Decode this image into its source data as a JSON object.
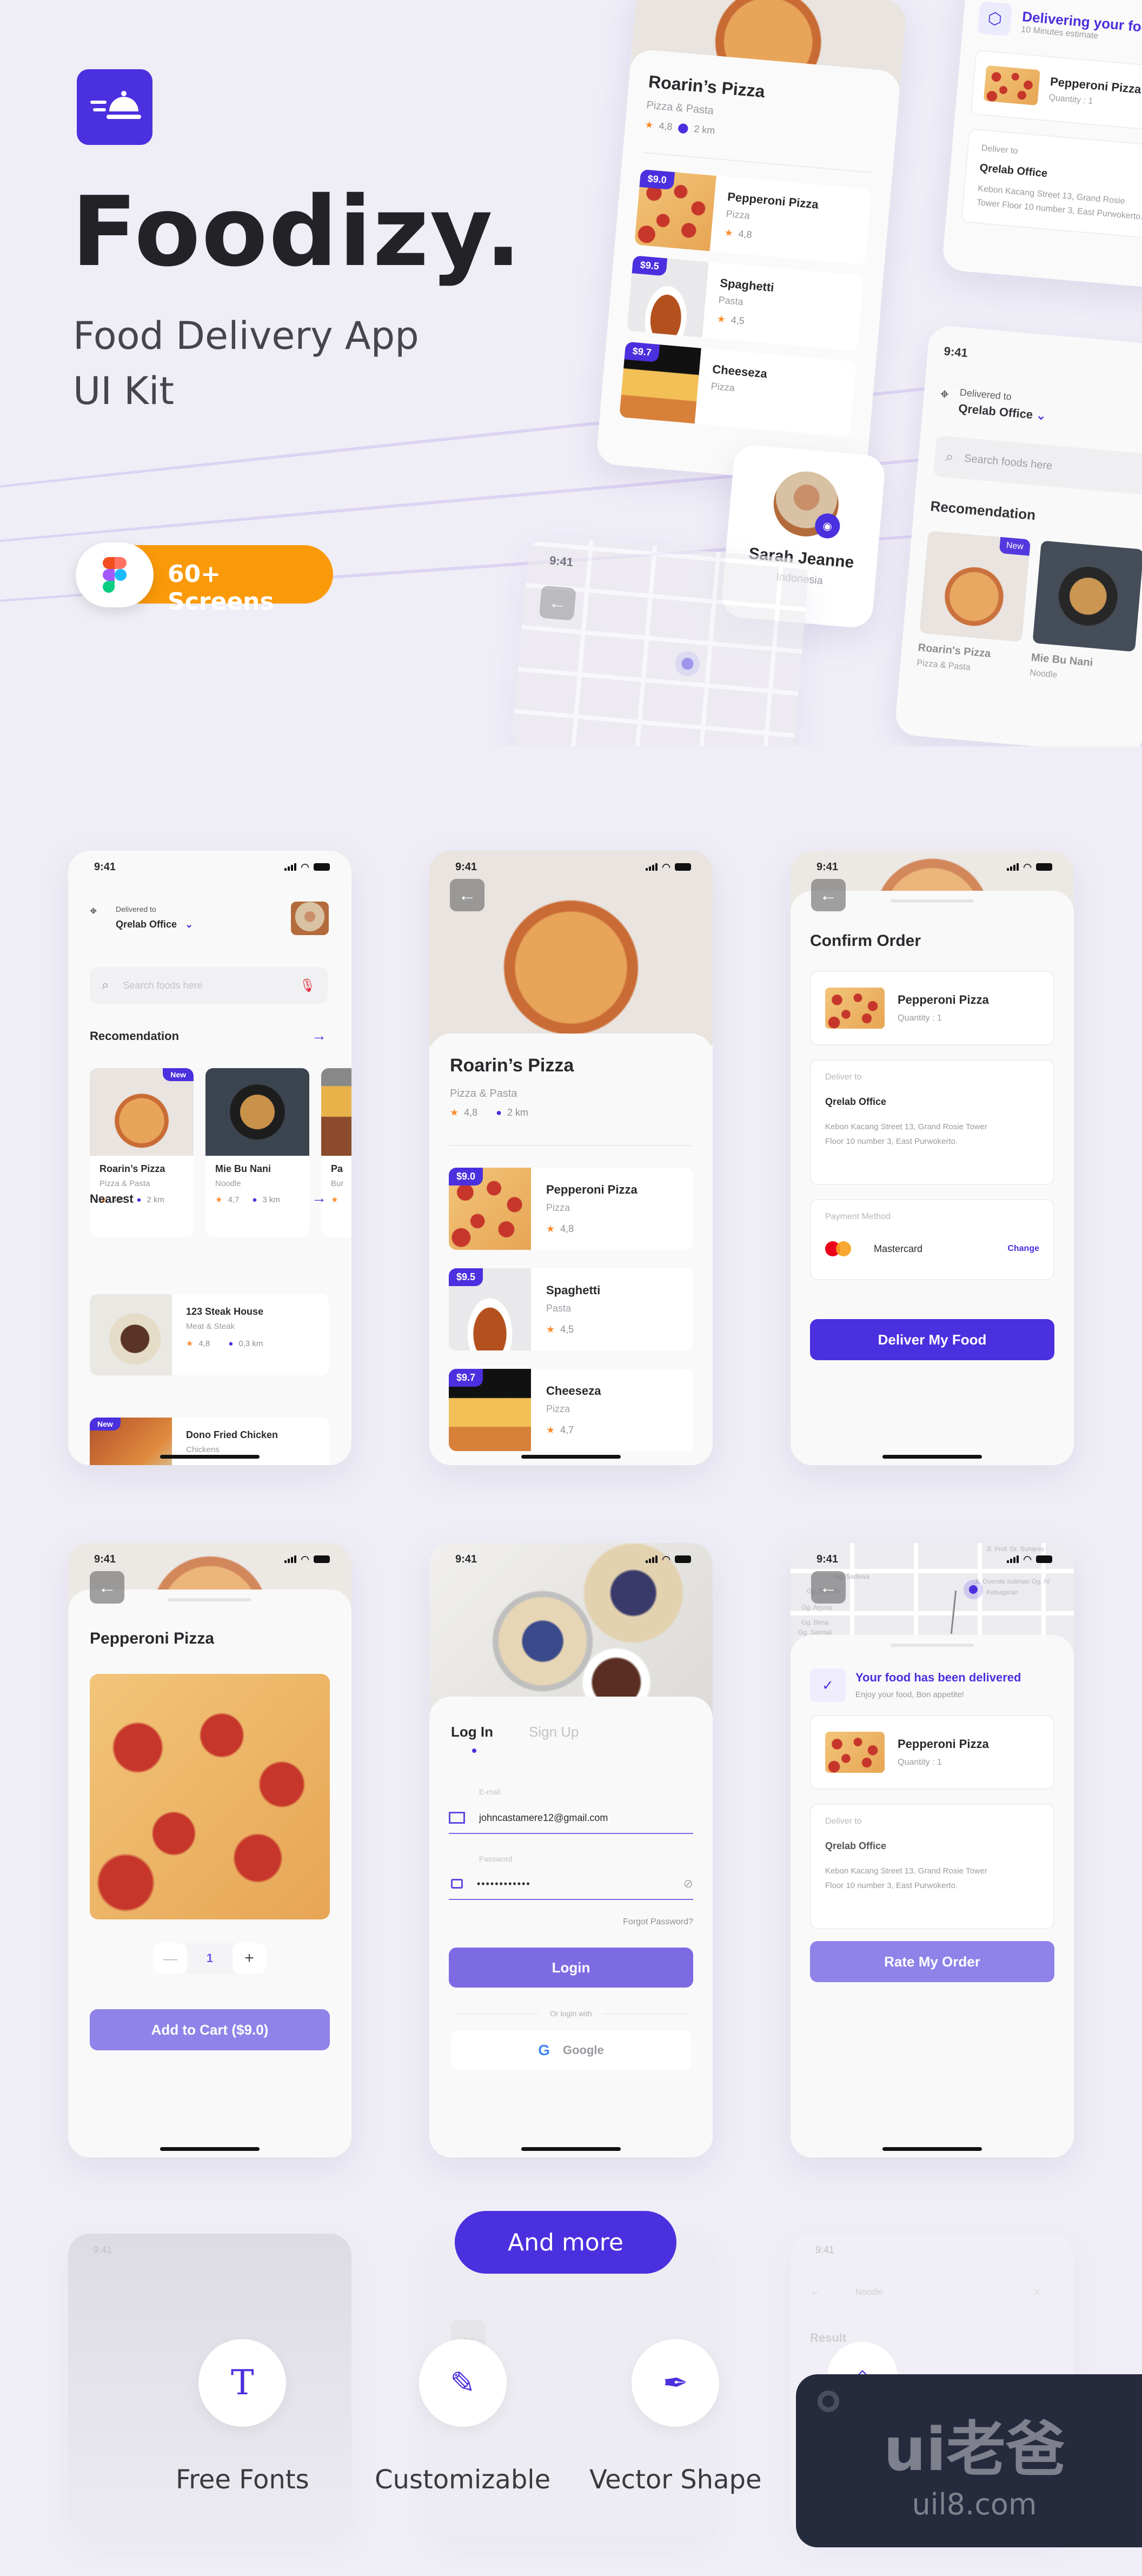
{
  "hero": {
    "brand": "Foodizy.",
    "subtitle_line1": "Food Delivery App",
    "subtitle_line2": "UI Kit",
    "badge_label": "60+ Screens",
    "logo_icon": "cloche-delivery-icon",
    "figma_icon": "figma-logo-icon",
    "colors": {
      "accent": "#4a30de",
      "badge": "#fb9a09",
      "background": "#efedf6"
    }
  },
  "hero_preview": {
    "restaurant": {
      "name": "Roarin’s Pizza",
      "category": "Pizza & Pasta",
      "rating": "4,8",
      "distance": "2 km"
    },
    "menu": [
      {
        "price": "$9.0",
        "name": "Pepperoni Pizza",
        "category": "Pizza",
        "rating": "4,8"
      },
      {
        "price": "$9.5",
        "name": "Spaghetti",
        "category": "Pasta",
        "rating": "4,5"
      },
      {
        "price": "$9.7",
        "name": "Cheeseza",
        "category": "Pizza",
        "rating": "4,7"
      }
    ],
    "delivering": {
      "title": "Delivering your food",
      "subtitle": "10 Minutes estimate",
      "item": "Pepperoni Pizza",
      "quantity": "Quantity : 1",
      "deliver_label": "Deliver to",
      "place": "Qrelab Office",
      "address": "Kebon Kacang Street 13, Grand Rosie Tower Floor 10 number 3, East Purwokerto."
    },
    "profile": {
      "name": "Sarah Jeanne",
      "country": "Indonesia"
    },
    "home": {
      "time": "9:41",
      "delivered_label": "Delivered to",
      "location": "Qrelab Office",
      "search_placeholder": "Search foods here",
      "section": "Recomendation",
      "new_badge": "New",
      "cards": [
        {
          "name": "Roarin's Pizza",
          "category": "Pizza & Pasta"
        },
        {
          "name": "Mie Bu Nani",
          "category": "Noodle"
        }
      ]
    },
    "map_time": "9:41"
  },
  "screens": {
    "time": "9:41",
    "home": {
      "delivered_label": "Delivered to",
      "location": "Qrelab Office",
      "search_placeholder": "Search foods here",
      "recommendation_title": "Recomendation",
      "nearest_title": "Nearest",
      "recommendations": [
        {
          "name": "Roarin’s Pizza",
          "category": "Pizza & Pasta",
          "rating": "4,8",
          "distance": "2 km",
          "badge": "New"
        },
        {
          "name": "Mie Bu Nani",
          "category": "Noodle",
          "rating": "4,7",
          "distance": "3 km",
          "badge": ""
        },
        {
          "name": "Pa",
          "category": "Bur",
          "rating": "",
          "distance": "",
          "badge": ""
        }
      ],
      "nearest": [
        {
          "name": "123 Steak House",
          "category": "Meat & Steak",
          "rating": "4,8",
          "distance": "0,3 km",
          "badge": ""
        },
        {
          "name": "Dono Fried Chicken",
          "category": "Chickens",
          "rating": "",
          "distance": "",
          "badge": "New"
        }
      ]
    },
    "restaurant": {
      "name": "Roarin’s Pizza",
      "category": "Pizza & Pasta",
      "rating": "4,8",
      "distance": "2 km",
      "menu": [
        {
          "price": "$9.0",
          "name": "Pepperoni Pizza",
          "category": "Pizza",
          "rating": "4,8"
        },
        {
          "price": "$9.5",
          "name": "Spaghetti",
          "category": "Pasta",
          "rating": "4,5"
        },
        {
          "price": "$9.7",
          "name": "Cheeseza",
          "category": "Pizza",
          "rating": "4,7"
        }
      ]
    },
    "confirm": {
      "title": "Confirm Order",
      "item_name": "Pepperoni Pizza",
      "quantity": "Quantity : 1",
      "deliver_label": "Deliver to",
      "place": "Qrelab Office",
      "address_line1": "Kebon Kacang Street 13, Grand Rosie Tower",
      "address_line2": "Floor 10 number 3, East Purwokerto.",
      "payment_label": "Payment Method",
      "payment_method": "Mastercard",
      "change_label": "Change",
      "cta": "Deliver My Food"
    },
    "product": {
      "title": "Pepperoni Pizza",
      "quantity": "1",
      "minus": "—",
      "plus": "+",
      "cta": "Add to Cart ($9.0)"
    },
    "login": {
      "tab_login": "Log In",
      "tab_signup": "Sign Up",
      "email_label": "E-mail",
      "email_value": "johncastamere12@gmail.com",
      "password_label": "Password",
      "password_value": "••••••••••••",
      "forgot": "Forgot Password?",
      "cta": "Login",
      "divider": "Or login with",
      "google": "Google"
    },
    "delivered": {
      "title": "Your food has been delivered",
      "subtitle": "Enjoy your food, Bon appetite!",
      "item_name": "Pepperoni Pizza",
      "quantity": "Quantity : 1",
      "deliver_label": "Deliver to",
      "place": "Qrelab Office",
      "address_line1": "Kebon Kacang Street 13, Grand Rosie Tower",
      "address_line2": "Floor 10 number 3, East Purwokerto.",
      "cta": "Rate My Order",
      "map_labels": [
        "Gg. Sadewa",
        "Gg. Nakula",
        "Gg. Arjuna",
        "Gg. Bima",
        "Gg. Samiaji",
        "Jl. Overste Isdiman Gg. IV",
        "Kebugaran",
        "Jl. Prof. Dr. Suharso"
      ]
    }
  },
  "footer": {
    "and_more": "And more",
    "features": [
      {
        "label": "Free Fonts",
        "icon": "text-font-icon"
      },
      {
        "label": "Customizable",
        "icon": "edit-icon"
      },
      {
        "label": "Vector Shape",
        "icon": "pen-tool-icon"
      }
    ],
    "faded_screen_time": "9:41",
    "faded_search": "Noodle",
    "faded_result": "Result",
    "watermark_main": "ui老爸",
    "watermark_url": "uil8.com"
  }
}
